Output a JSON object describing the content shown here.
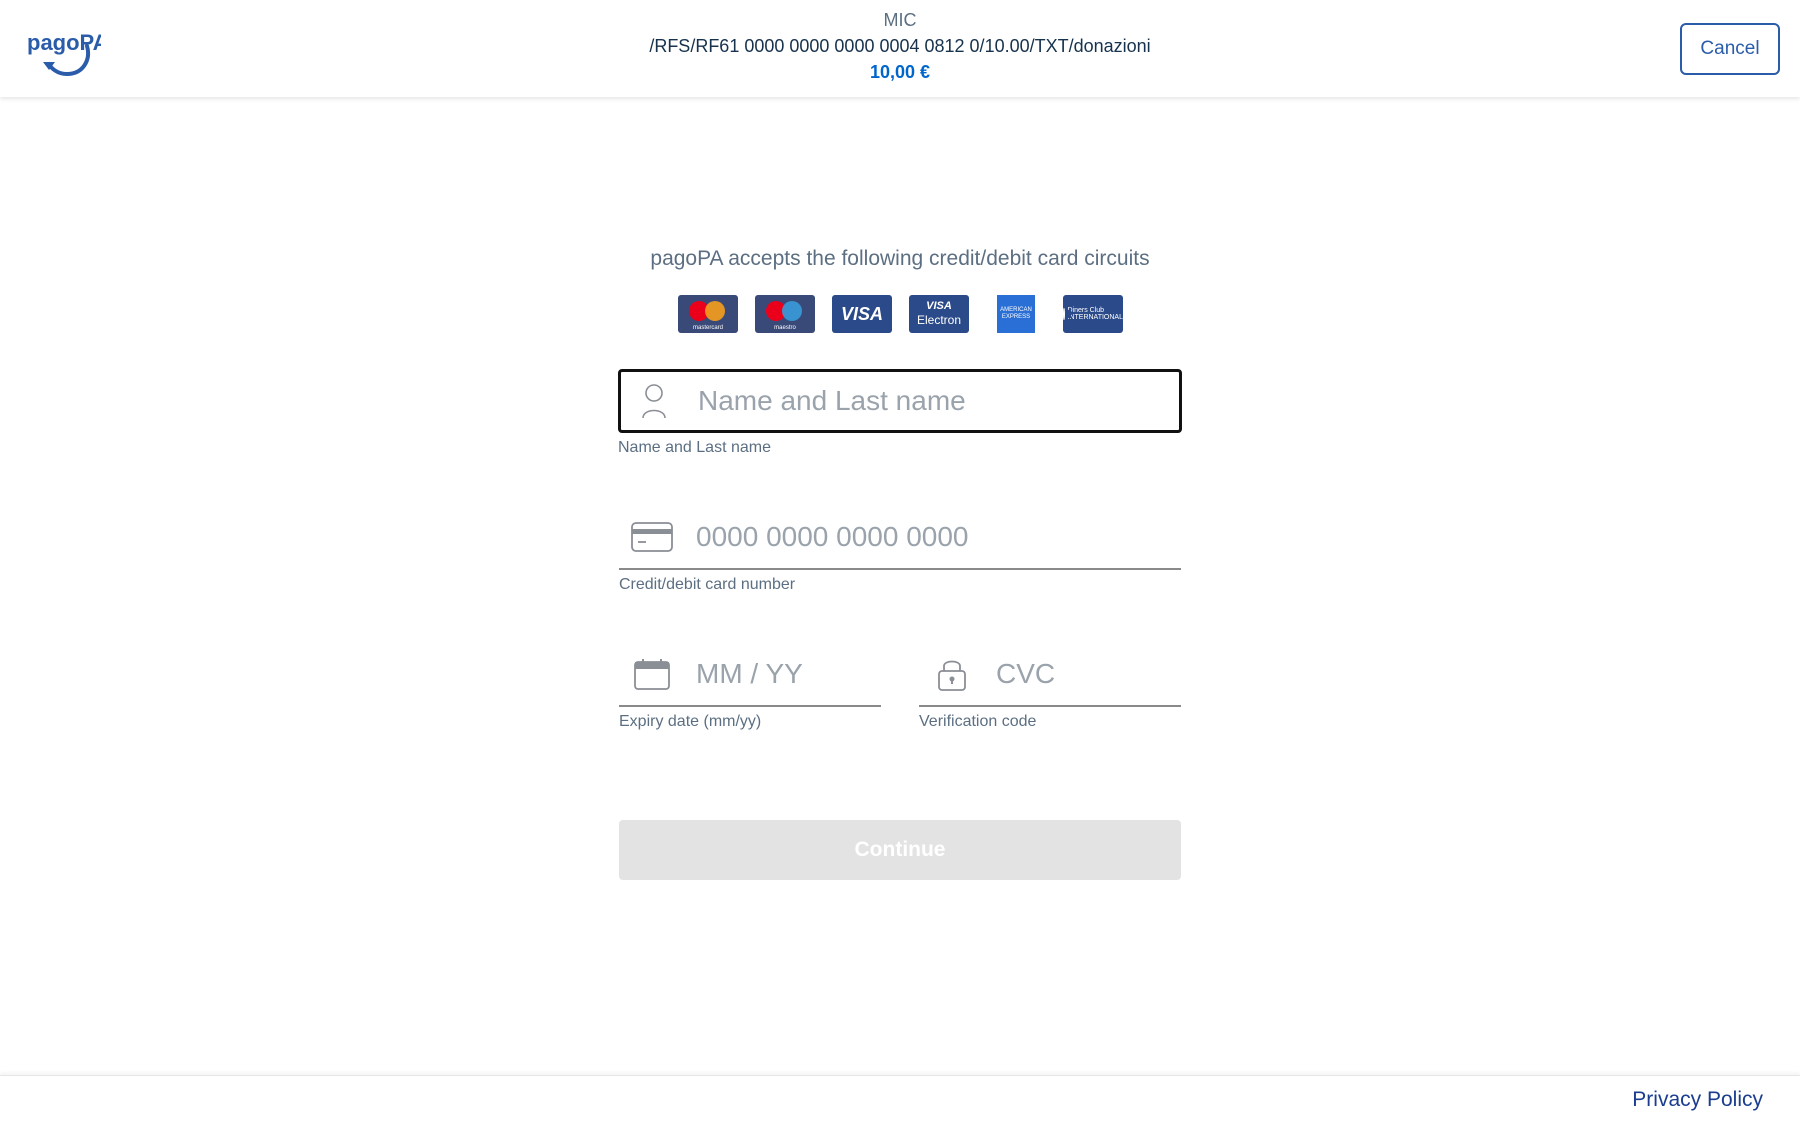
{
  "header": {
    "logo_text": "pagoPA",
    "organization": "MIC",
    "payment_code": "/RFS/RF61 0000 0000 0000 0004 0812 0/10.00/TXT/donazioni",
    "amount": "10,00 €",
    "cancel_label": "Cancel"
  },
  "main": {
    "circuits_title": "pagoPA accepts the following credit/debit card circuits",
    "card_circuits": [
      {
        "name": "mastercard",
        "caption": "mastercard"
      },
      {
        "name": "maestro",
        "caption": "maestro"
      },
      {
        "name": "visa",
        "caption": "VISA"
      },
      {
        "name": "visa-electron",
        "caption_top": "VISA",
        "caption_bottom": "Electron"
      },
      {
        "name": "american-express",
        "caption_top": "AMERICAN",
        "caption_bottom": "EXPRESS"
      },
      {
        "name": "diners-club",
        "caption_top": "Diners Club",
        "caption_bottom": "INTERNATIONAL"
      }
    ],
    "fields": {
      "name": {
        "placeholder": "Name and Last name",
        "label": "Name and Last name",
        "value": "",
        "icon": "user-icon"
      },
      "card_number": {
        "placeholder": "0000 0000 0000 0000",
        "label": "Credit/debit card number",
        "value": "",
        "icon": "credit-card-icon"
      },
      "expiry": {
        "placeholder": "MM / YY",
        "label": "Expiry date (mm/yy)",
        "value": "",
        "icon": "calendar-icon"
      },
      "cvc": {
        "placeholder": "CVC",
        "label": "Verification code",
        "value": "",
        "icon": "lock-icon"
      }
    },
    "continue_label": "Continue"
  },
  "footer": {
    "privacy_label": "Privacy Policy"
  },
  "colors": {
    "brand_blue": "#0066cc",
    "cancel_border": "#2a5caa",
    "disabled_button": "#e3e3e3",
    "text_muted": "#5c6f82",
    "text_dark": "#17324d"
  }
}
